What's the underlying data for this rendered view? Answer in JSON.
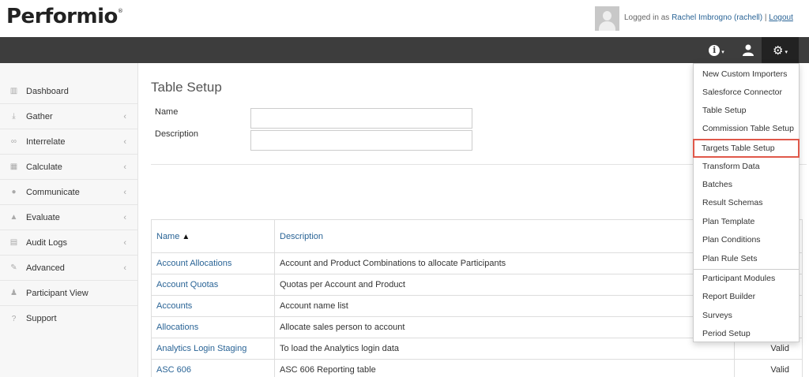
{
  "header": {
    "logo": "Performio",
    "logo_mark": "®",
    "logged_in_prefix": "Logged in as",
    "user_name": "Rachel Imbrogno (rachell)",
    "separator": "|",
    "logout": "Logout"
  },
  "navbar": {
    "icons": [
      "info-icon",
      "user-icon",
      "gear-icon"
    ]
  },
  "sidebar": {
    "items": [
      {
        "label": "Dashboard",
        "icon": "bar-chart-icon",
        "chevron": false
      },
      {
        "label": "Gather",
        "icon": "download-icon",
        "chevron": true
      },
      {
        "label": "Interrelate",
        "icon": "link-icon",
        "chevron": true
      },
      {
        "label": "Calculate",
        "icon": "table-icon",
        "chevron": true
      },
      {
        "label": "Communicate",
        "icon": "comments-icon",
        "chevron": true
      },
      {
        "label": "Evaluate",
        "icon": "thumbs-up-icon",
        "chevron": true
      },
      {
        "label": "Audit Logs",
        "icon": "file-icon",
        "chevron": true
      },
      {
        "label": "Advanced",
        "icon": "wrench-icon",
        "chevron": true
      },
      {
        "label": "Participant View",
        "icon": "person-icon",
        "chevron": false
      },
      {
        "label": "Support",
        "icon": "question-icon",
        "chevron": false
      }
    ]
  },
  "main": {
    "title": "Table Setup",
    "name_label": "Name",
    "name_value": "",
    "description_label": "Description",
    "description_value": ""
  },
  "table": {
    "headers": {
      "name": "Name",
      "description": "Description",
      "status": ""
    },
    "rows": [
      {
        "name": "Account Allocations",
        "description": "Account and Product Combinations to allocate Participants",
        "status": ""
      },
      {
        "name": "Account Quotas",
        "description": "Quotas per Account and Product",
        "status": ""
      },
      {
        "name": "Accounts",
        "description": "Account name list",
        "status": ""
      },
      {
        "name": "Allocations",
        "description": "Allocate sales person to account",
        "status": ""
      },
      {
        "name": "Analytics Login Staging",
        "description": "To load the Analytics login data",
        "status": "Valid"
      },
      {
        "name": "ASC 606",
        "description": "ASC 606 Reporting table",
        "status": "Valid"
      }
    ]
  },
  "dropdown": {
    "group1": [
      "New Custom Importers",
      "Salesforce Connector",
      "Table Setup",
      "Commission Table Setup",
      "Targets Table Setup",
      "Transform Data",
      "Batches",
      "Result Schemas",
      "Plan Template",
      "Plan Conditions",
      "Plan Rule Sets"
    ],
    "group2": [
      "Participant Modules",
      "Report Builder",
      "Surveys",
      "Period Setup"
    ],
    "highlighted": "Targets Table Setup"
  },
  "colors": {
    "navbar": "#3d3d3d",
    "link": "#2a6496",
    "highlight_border": "#e0584a"
  }
}
